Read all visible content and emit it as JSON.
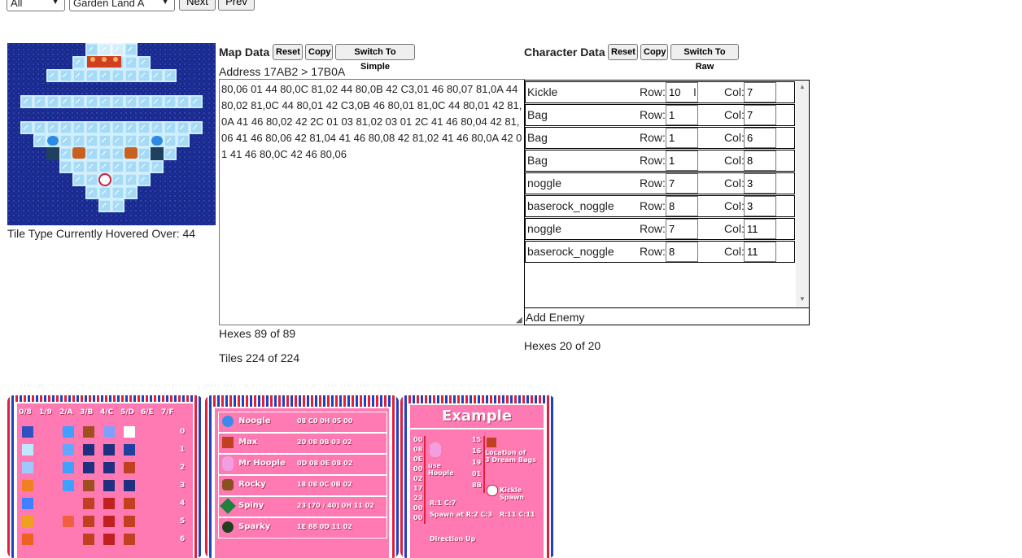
{
  "toolbar": {
    "filter_value": "All",
    "level_value": "Garden Land A",
    "next_label": "Next",
    "prev_label": "Prev"
  },
  "map": {
    "hover_label": "Tile Type Currently Hovered Over: 44"
  },
  "map_data": {
    "title": "Map Data",
    "reset_label": "Reset",
    "copy_label": "Copy",
    "switch_label": "Switch To Simple",
    "address": "Address 17AB2 > 17B0A",
    "hex": "80,06 01 44 80,0C 81,02 44 80,0B 42 C3,01 46 80,07 81,0A 44 80,02 81,0C 44 80,01 42 C3,0B 46 80,01 81,0C 44 80,01 42 81,0A 41 46 80,02 42 2C 01 03 81,02 03 01 2C 41 46 80,04 42 81,06 41 46 80,06 42 81,04 41 46 80,08 42 81,02 41 46 80,0A 42 01 41 46 80,0C 42 46 80,06",
    "hex_count": "Hexes 89 of 89",
    "tiles_count": "Tiles 224 of 224"
  },
  "character_data": {
    "title": "Character Data",
    "reset_label": "Reset",
    "copy_label": "Copy",
    "switch_label": "Switch To Raw",
    "row_label": "Row:",
    "col_label": "Col:",
    "characters": [
      {
        "name": "Kickle",
        "row": "10",
        "col": "7"
      },
      {
        "name": "Bag",
        "row": "1",
        "col": "7"
      },
      {
        "name": "Bag",
        "row": "1",
        "col": "6"
      },
      {
        "name": "Bag",
        "row": "1",
        "col": "8"
      },
      {
        "name": "noggle",
        "row": "7",
        "col": "3"
      },
      {
        "name": "baserock_noggle",
        "row": "8",
        "col": "3"
      },
      {
        "name": "noggle",
        "row": "7",
        "col": "11"
      },
      {
        "name": "baserock_noggle",
        "row": "8",
        "col": "11"
      }
    ],
    "add_enemy_label": "Add Enemy",
    "hex_count": "Hexes 20 of 20"
  },
  "tile_chart": {
    "headers": [
      "0/8",
      "1/9",
      "2/A",
      "3/B",
      "4/C",
      "5/D",
      "6/E",
      "7/F"
    ],
    "row_numbers": [
      "0",
      "1",
      "2",
      "3",
      "4",
      "5",
      "6"
    ]
  },
  "enemy_chart": {
    "entries": [
      {
        "name": "Noogle",
        "code": "08 C0 0H 05 00"
      },
      {
        "name": "Max",
        "code": "20 08 0B 03 02"
      },
      {
        "name": "Mr Hoople",
        "code": "0D 08 0E 0B 02"
      },
      {
        "name": "Rocky",
        "code": "18 08 0C 0B 02"
      },
      {
        "name": "Spiny",
        "code": "23 [70 / 40] 0H 11 02"
      },
      {
        "name": "Sparky",
        "code": "1E 88 0D 11 02"
      }
    ]
  },
  "example_chart": {
    "title": "Example",
    "left_codes": [
      "00",
      "08",
      "0E",
      "00",
      "02",
      "17",
      "23",
      "00",
      "00"
    ],
    "right_codes": [
      "15",
      "16",
      "19",
      "01",
      "8B"
    ],
    "notes": {
      "use_hoople": "use\nHoople",
      "location": "Location of\n3 Dream Bags",
      "kickle_spawn": "Kickle\nSpawn",
      "r_c": "R:1 C:7",
      "spawn_at": "Spawn at R:2 C:3",
      "r11": "R:11 C:11",
      "direction": "Direction Up"
    }
  },
  "colors": {
    "map_water": "#1a2a8e",
    "ice": "#bfe8ff",
    "panel_pink": "#ff7ab3",
    "panel_stripe_red": "#e0203a",
    "panel_stripe_blue": "#2040c0"
  }
}
